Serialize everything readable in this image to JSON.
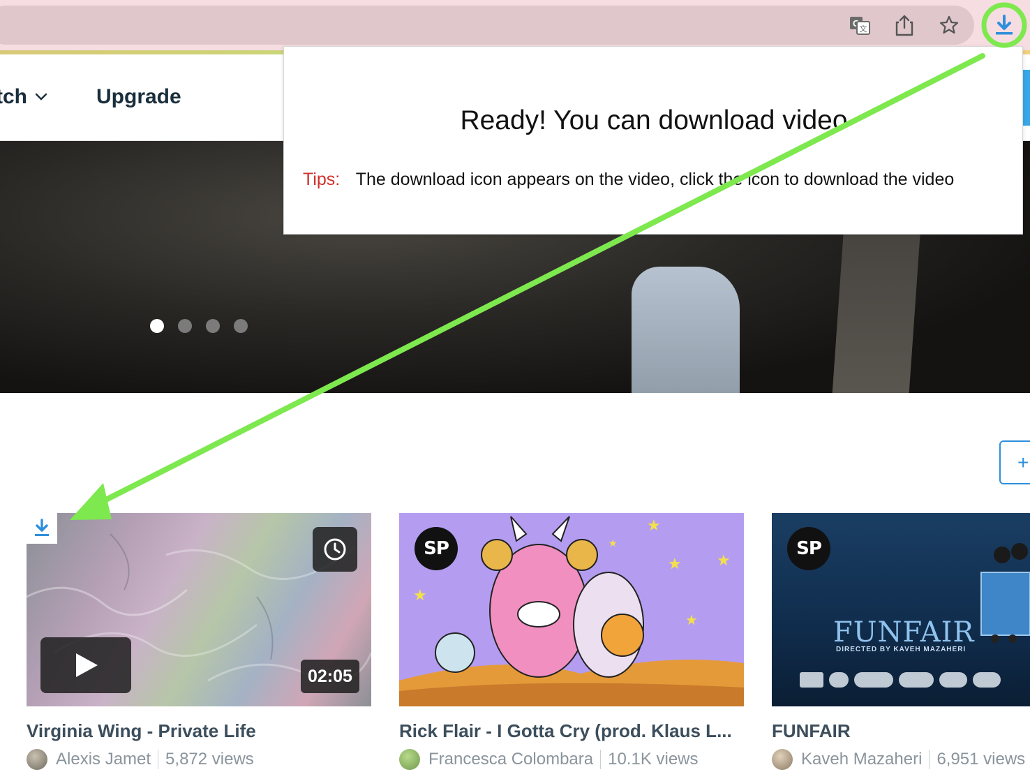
{
  "browser": {
    "toolbar_icons": [
      "translate-icon",
      "share-icon",
      "bookmark-star-icon",
      "download-extension-icon"
    ]
  },
  "header": {
    "nav_watch": "tch",
    "nav_upgrade": "Upgrade"
  },
  "hero": {
    "carousel_dots": 4,
    "active_dot": 1
  },
  "popup": {
    "title": "Ready! You can download video",
    "tips_label": "Tips:",
    "tips_text": "The download icon appears on the video, click the icon to download the video"
  },
  "follow_button": {
    "label": "+"
  },
  "videos": [
    {
      "title": "Virginia Wing - Private Life",
      "author": "Alexis Jamet",
      "views": "5,872 views",
      "duration": "02:05"
    },
    {
      "title": "Rick Flair - I Gotta Cry (prod. Klaus L...",
      "author": "Francesca Colombara",
      "views": "10.1K views",
      "badge": "SP"
    },
    {
      "title": "FUNFAIR",
      "author": "Kaveh Mazaheri",
      "views": "6,951 views",
      "badge": "SP",
      "poster_title": "FUNFAIR",
      "poster_credit": "DIRECTED BY  KAVEH MAZAHERI"
    }
  ],
  "colors": {
    "annotation_green": "#7ee84f",
    "accent_blue": "#2f8fdc",
    "tips_red": "#d0302b",
    "heading_dark": "#1a2e3b"
  }
}
